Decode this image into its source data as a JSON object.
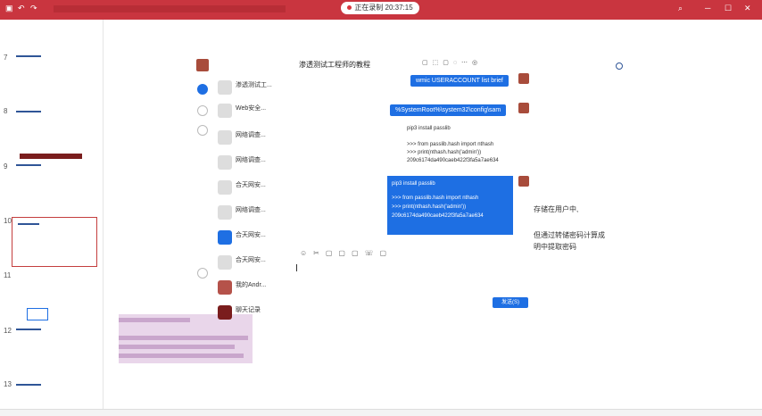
{
  "recording": {
    "label": "正在录制 20:37:15"
  },
  "slides": [
    {
      "num": "7"
    },
    {
      "num": "8"
    },
    {
      "num": "9"
    },
    {
      "num": "10"
    },
    {
      "num": "11"
    },
    {
      "num": "12"
    },
    {
      "num": "13"
    }
  ],
  "chat": {
    "title": "渗透测试工程师的教程",
    "conversations": [
      {
        "title": "渗透测试工...",
        "sub": ""
      },
      {
        "title": "Web安全...",
        "sub": ""
      },
      {
        "title": "网络调查...",
        "sub": ""
      },
      {
        "title": "网络调查...",
        "sub": ""
      },
      {
        "title": "合天网安...",
        "sub": ""
      },
      {
        "title": "网络调查...",
        "sub": ""
      },
      {
        "title": "合天网安...",
        "sub": ""
      },
      {
        "title": "合天网安...",
        "sub": ""
      },
      {
        "title": "我的Andr...",
        "sub": ""
      },
      {
        "title": "聊天记录",
        "sub": ""
      }
    ],
    "messages": {
      "m1": "wmic USERACCOUNT list brief",
      "m2": "%SystemRoot%\\system32\\config\\sam",
      "m3": "pip3 install passlib\n\n>>> from passlib.hash import nthash\n>>> print(nthash.hash('admin'))\n209c6174da490caeb422f3fa5a7ae634",
      "m4_l1": "pip3 install passlib",
      "m4_l2": ">>> from passlib.hash import nthash",
      "m4_l3": ">>> print(nthash.hash('admin'))",
      "m4_l4": "209c6174da490caeb422f3fa5a7ae634"
    },
    "send_label": "发送(S)"
  },
  "side_notes": {
    "n1": "存储在用户中,",
    "n2": "但通过转储密码计算成",
    "n3": "明中提取密码"
  }
}
